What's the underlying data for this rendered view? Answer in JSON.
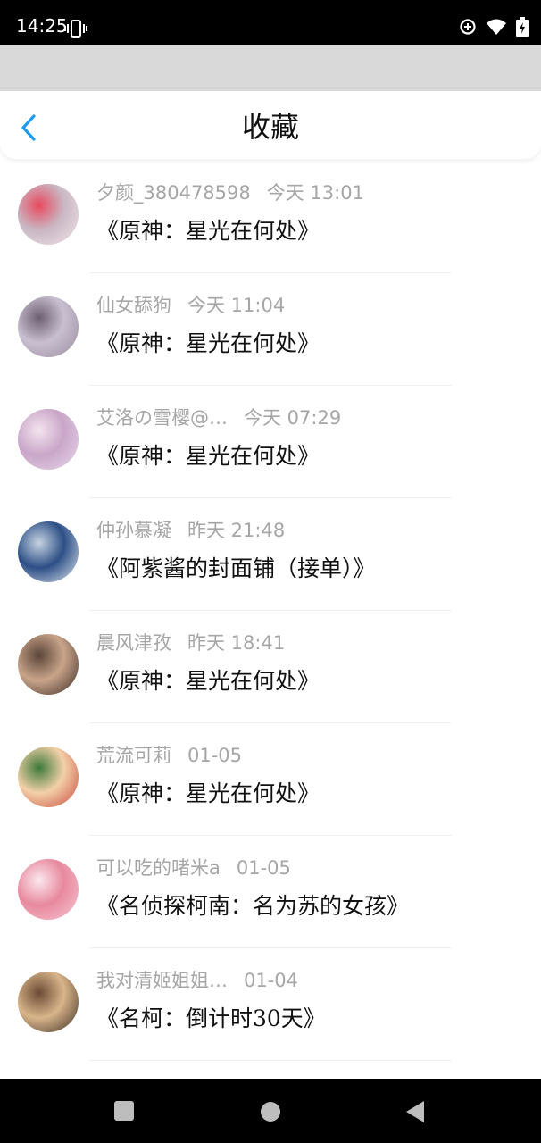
{
  "status_bar": {
    "time": "14:25",
    "icons": [
      "vibrate-icon",
      "data-saver-icon",
      "wifi-icon",
      "battery-icon"
    ]
  },
  "header": {
    "title": "收藏",
    "back_icon": "chevron-left-icon",
    "accent_color": "#1a9af0"
  },
  "favorites": [
    {
      "author": "夕颜_380478598",
      "time": "今天 13:01",
      "title": "《原神：星光在何处》",
      "avatar_colors": [
        "#f2e6ea",
        "#c9b7c3",
        "#e84a5f"
      ]
    },
    {
      "author": "仙女舔狗",
      "time": "今天 11:04",
      "title": "《原神：星光在何处》",
      "avatar_colors": [
        "#9a8a9c",
        "#c8bfd0",
        "#6e5f73"
      ]
    },
    {
      "author": "艾洛の雪樱@…",
      "time": "今天 07:29",
      "title": "《原神：星光在何处》",
      "avatar_colors": [
        "#e8d8ec",
        "#c9a6c8",
        "#f4e4ef"
      ]
    },
    {
      "author": "仲孙慕凝",
      "time": "昨天 21:48",
      "title": "《阿紫酱的封面铺（接单）》",
      "avatar_colors": [
        "#e4ecf2",
        "#2d4f86",
        "#c6d4e2"
      ]
    },
    {
      "author": "晨风津孜",
      "time": "昨天 18:41",
      "title": "《原神：星光在何处》",
      "avatar_colors": [
        "#3a2a22",
        "#c9a48a",
        "#5a4538"
      ]
    },
    {
      "author": "荒流可莉",
      "time": "01-05",
      "title": "《原神：星光在何处》",
      "avatar_colors": [
        "#c9453a",
        "#f2d0a8",
        "#3d7a3a"
      ]
    },
    {
      "author": "可以吃的啫米a",
      "time": "01-05",
      "title": "《名侦探柯南：名为苏的女孩》",
      "avatar_colors": [
        "#f6c8d4",
        "#e8899e",
        "#fbe8ee"
      ]
    },
    {
      "author": "我对清姬姐姐…",
      "time": "01-04",
      "title": "《名柯：倒计时30天》",
      "avatar_colors": [
        "#3b2a22",
        "#d8b58a",
        "#6b4a35"
      ]
    }
  ],
  "nav_bar": {
    "icons": [
      "recents-square-icon",
      "home-circle-icon",
      "back-triangle-icon"
    ]
  }
}
